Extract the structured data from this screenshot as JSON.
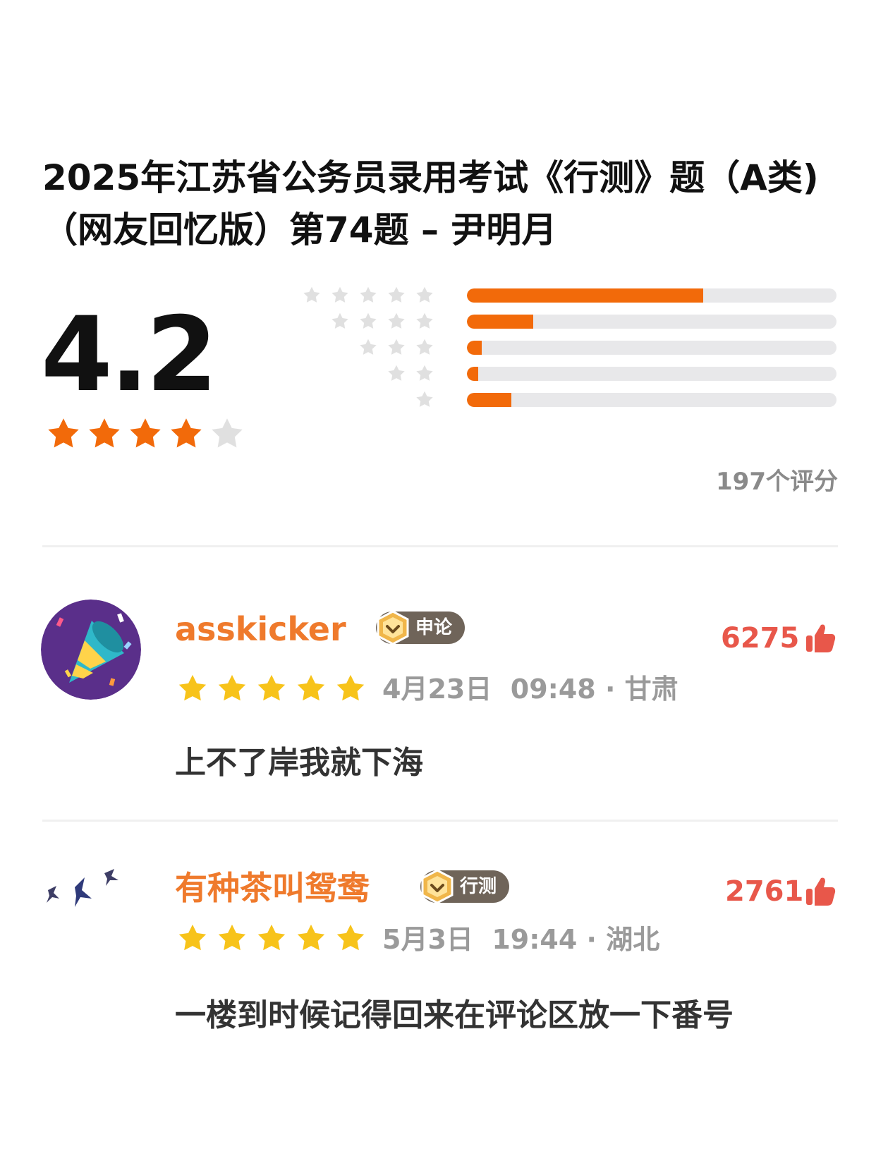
{
  "title": "2025年江苏省公务员录用考试《行测》题（A类)（网友回忆版）第74题 – 尹明月",
  "rating": {
    "score": "4.2",
    "score_value": 4.2,
    "count_label": "197个评分",
    "distribution": [
      {
        "stars": 5,
        "fraction": 0.64
      },
      {
        "stars": 4,
        "fraction": 0.18
      },
      {
        "stars": 3,
        "fraction": 0.04
      },
      {
        "stars": 2,
        "fraction": 0.03
      },
      {
        "stars": 1,
        "fraction": 0.12
      }
    ]
  },
  "colors": {
    "accent_orange": "#f26a0a",
    "star_yellow": "#f7c31a",
    "star_grey": "#e0e0e0",
    "username": "#ef7a2c",
    "likes": "#e8574a"
  },
  "reviews": [
    {
      "username": "asskicker",
      "badge": "申论",
      "likes": "6275",
      "stars": 5,
      "date": "4月23日",
      "time": "09:48",
      "location": "甘肃",
      "meta": "4月23日  09:48 · 甘肃",
      "comment": "上不了岸我就下海",
      "avatar_icon": "party-popper-icon"
    },
    {
      "username": "有种茶叫鸳鸯",
      "badge": "行测",
      "likes": "2761",
      "stars": 5,
      "date": "5月3日",
      "time": "19:44",
      "location": "湖北",
      "meta": "5月3日  19:44 · 湖北",
      "comment": "一楼到时候记得回来在评论区放一下番号",
      "avatar_icon": "birds-icon"
    }
  ]
}
